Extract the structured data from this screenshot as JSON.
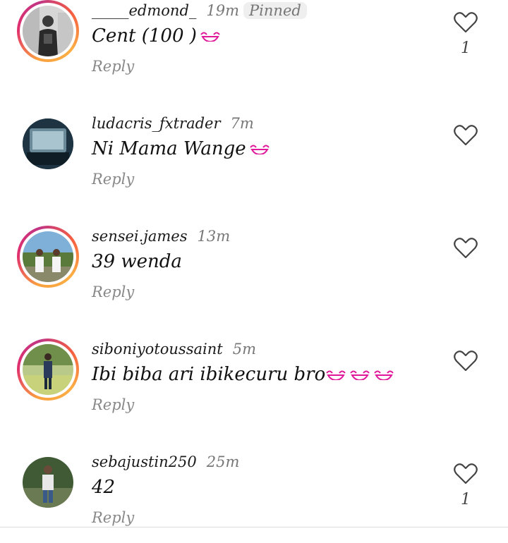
{
  "comments": [
    {
      "username": "_____edmond_",
      "time": "19m",
      "pinned": "Pinned",
      "text": "Cent (100 )",
      "emoji_count": 1,
      "reply": "Reply",
      "likes": "1",
      "ring": true
    },
    {
      "username": "ludacris_fxtrader",
      "time": "7m",
      "text": "Ni Mama Wange ",
      "emoji_count": 1,
      "reply": "Reply",
      "ring": false
    },
    {
      "username": "sensei.james",
      "time": "13m",
      "text": "39 wenda",
      "emoji_count": 0,
      "reply": "Reply",
      "ring": true
    },
    {
      "username": "siboniyotoussaint",
      "time": "5m",
      "text": "Ibi biba ari ibikecuru bro",
      "emoji_count": 3,
      "reply": "Reply",
      "ring": true
    },
    {
      "username": "sebajustin250",
      "time": "25m",
      "text": "42",
      "emoji_count": 0,
      "reply": "Reply",
      "likes": "1",
      "ring": false
    }
  ],
  "colors": {
    "emoji": "#e0189a",
    "heart": "#444444",
    "ring_start": "#f9a03f",
    "ring_end": "#c13584"
  },
  "icons": {
    "like": "heart-outline-icon",
    "emoji": "laughing-emoji-icon"
  }
}
